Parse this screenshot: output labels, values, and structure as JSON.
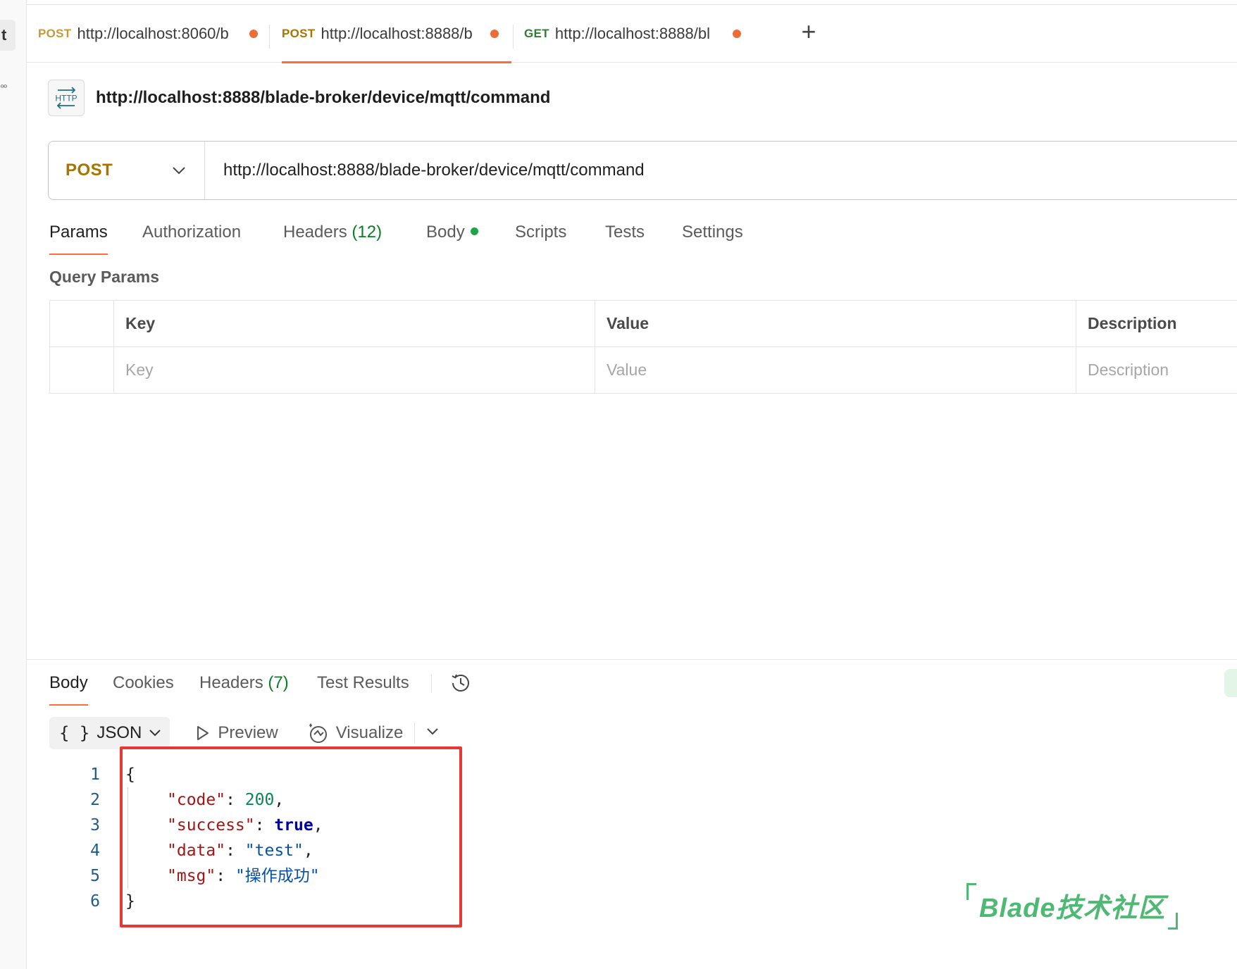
{
  "sidebar": {
    "tab_glyph": "t",
    "dots_glyph": "°°"
  },
  "tabs": [
    {
      "method": "POST",
      "url": "http://localhost:8060/b",
      "method_color": "#c59a3a",
      "active": false
    },
    {
      "method": "POST",
      "url": "http://localhost:8888/b",
      "method_color": "#a87400",
      "active": true
    },
    {
      "method": "GET",
      "url": "http://localhost:8888/bl",
      "method_color": "#2e7d32",
      "active": false
    }
  ],
  "request": {
    "title": "http://localhost:8888/blade-broker/device/mqtt/command",
    "badge_text": "HTTP",
    "method": "POST",
    "url": "http://localhost:8888/blade-broker/device/mqtt/command"
  },
  "request_tabs": {
    "params": "Params",
    "authorization": "Authorization",
    "headers": "Headers",
    "headers_count": "(12)",
    "body": "Body",
    "scripts": "Scripts",
    "tests": "Tests",
    "settings": "Settings"
  },
  "query_params": {
    "title": "Query Params",
    "columns": [
      "Key",
      "Value",
      "Description"
    ],
    "placeholders": [
      "Key",
      "Value",
      "Description"
    ]
  },
  "response_tabs": {
    "body": "Body",
    "cookies": "Cookies",
    "headers": "Headers",
    "headers_count": "(7)",
    "test_results": "Test Results"
  },
  "format_bar": {
    "braces": "{ }",
    "format": "JSON",
    "preview": "Preview",
    "visualize": "Visualize"
  },
  "response_body": {
    "line_numbers": [
      "1",
      "2",
      "3",
      "4",
      "5",
      "6"
    ],
    "open_brace": "{",
    "close_brace": "}",
    "fields": [
      {
        "key": "\"code\"",
        "value": "200"
      },
      {
        "key": "\"success\"",
        "value": "true"
      },
      {
        "key": "\"data\"",
        "value": "\"test\""
      },
      {
        "key": "\"msg\"",
        "value": "\"操作成功\""
      }
    ]
  },
  "watermark": {
    "text": "Blade技术社区"
  },
  "colors": {
    "accent": "#ff6c37",
    "unsaved_dot": "#eb6e37",
    "highlight_box": "#e53935",
    "watermark": "#4fb873"
  }
}
